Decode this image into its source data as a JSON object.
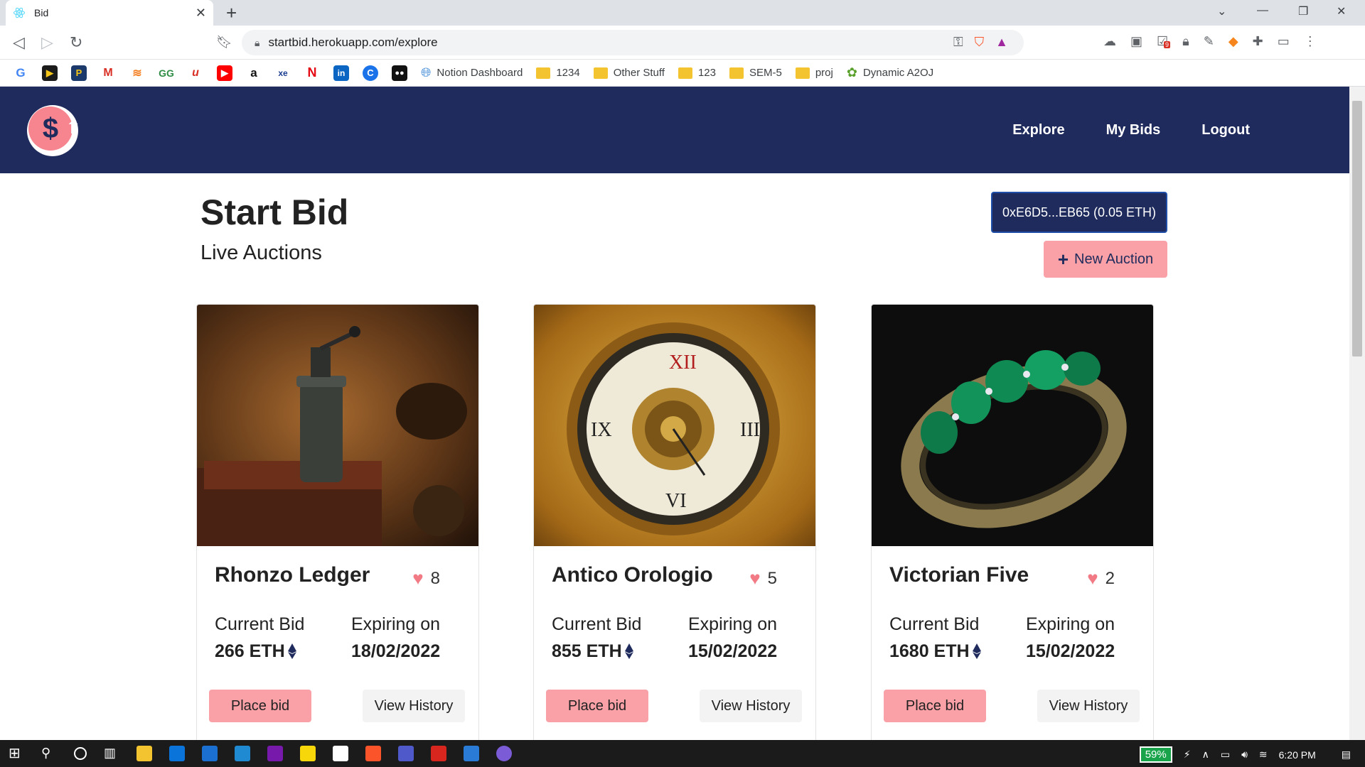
{
  "browser": {
    "tab_title": "Bid",
    "url": "startbid.herokuapp.com/explore",
    "bookmarks": [
      {
        "label": "Notion Dashboard",
        "kind": "link"
      },
      {
        "label": "1234",
        "kind": "folder"
      },
      {
        "label": "Other Stuff",
        "kind": "folder"
      },
      {
        "label": "123",
        "kind": "folder"
      },
      {
        "label": "SEM-5",
        "kind": "folder"
      },
      {
        "label": "proj",
        "kind": "folder"
      },
      {
        "label": "Dynamic A2OJ",
        "kind": "link"
      }
    ],
    "extension_badge": "9"
  },
  "nav": {
    "links": [
      "Explore",
      "My Bids",
      "Logout"
    ]
  },
  "header": {
    "title": "Start Bid",
    "subtitle": "Live Auctions",
    "wallet": "0xE6D5...EB65 (0.05 ETH)",
    "new_auction": "New Auction"
  },
  "labels": {
    "current_bid": "Current Bid",
    "expiring_on": "Expiring on",
    "place_bid": "Place bid",
    "view_history": "View History"
  },
  "cards": [
    {
      "name": "Rhonzo Ledger",
      "likes": "8",
      "bid": "266 ETH",
      "expiry": "18/02/2022"
    },
    {
      "name": "Antico Orologio",
      "likes": "5",
      "bid": "855 ETH",
      "expiry": "15/02/2022"
    },
    {
      "name": "Victorian Five",
      "likes": "2",
      "bid": "1680 ETH",
      "expiry": "15/02/2022"
    }
  ],
  "taskbar": {
    "battery": "59%",
    "time": "6:20 PM"
  },
  "colors": {
    "navy": "#1e2b5c",
    "pink": "#f9a1a7"
  }
}
